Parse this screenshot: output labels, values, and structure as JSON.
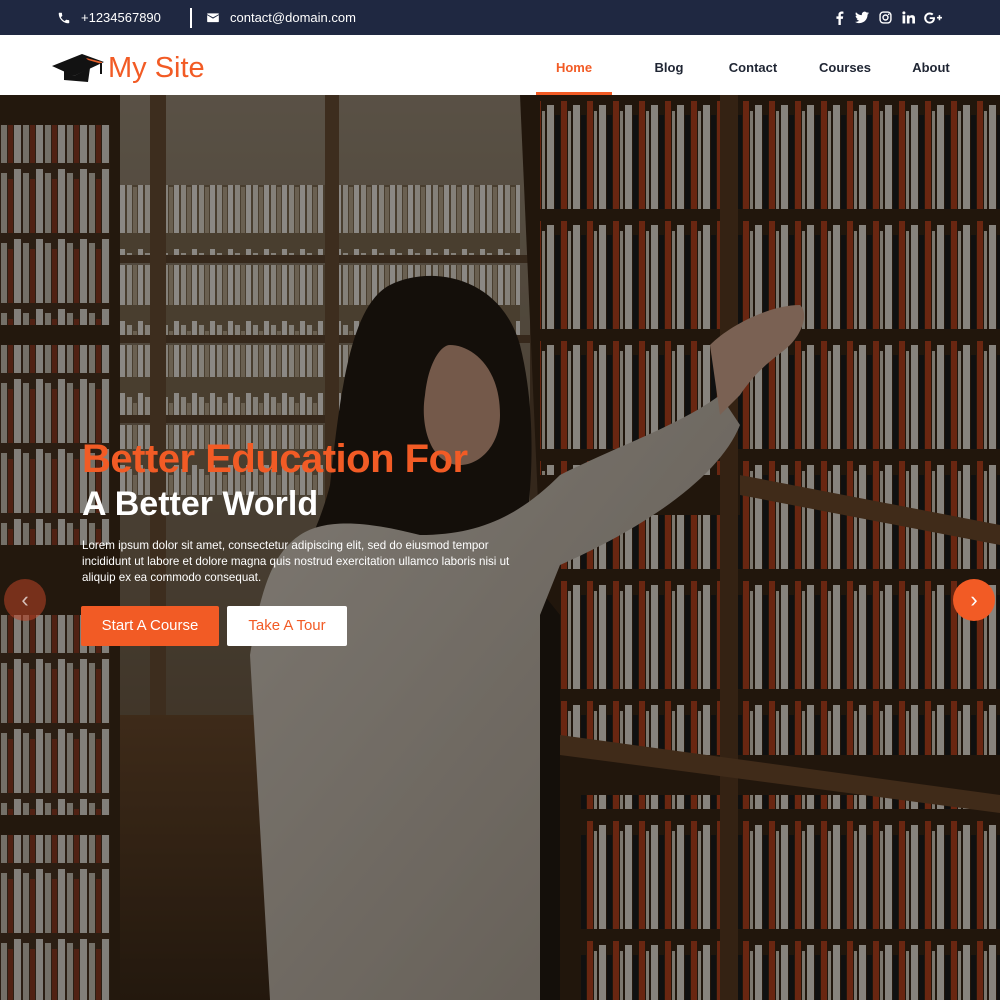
{
  "topbar": {
    "phone": "+1234567890",
    "email": "contact@domain.com",
    "socials": [
      "facebook-icon",
      "twitter-icon",
      "instagram-icon",
      "linkedin-icon",
      "google-plus-icon"
    ]
  },
  "nav": {
    "site_name": "My Site",
    "items": [
      {
        "label": "Home",
        "active": true
      },
      {
        "label": "Blog"
      },
      {
        "label": "Contact"
      },
      {
        "label": "Courses"
      },
      {
        "label": "About"
      }
    ]
  },
  "hero": {
    "headline_accent": "Better Education For",
    "headline_main": "A Better World",
    "lead": "Lorem ipsum dolor sit amet, consectetur adipiscing elit, sed do eiusmod tempor incididunt ut labore et dolore magna quis nostrud exercitation ullamco laboris nisi ut aliquip ex ea commodo consequat.",
    "primary_button": "Start A Course",
    "secondary_button": "Take A Tour",
    "prev_arrow": "‹",
    "next_arrow": "›"
  },
  "colors": {
    "accent": "#f25b25",
    "topbar": "#1f2841",
    "nav_text": "#1f2533"
  }
}
